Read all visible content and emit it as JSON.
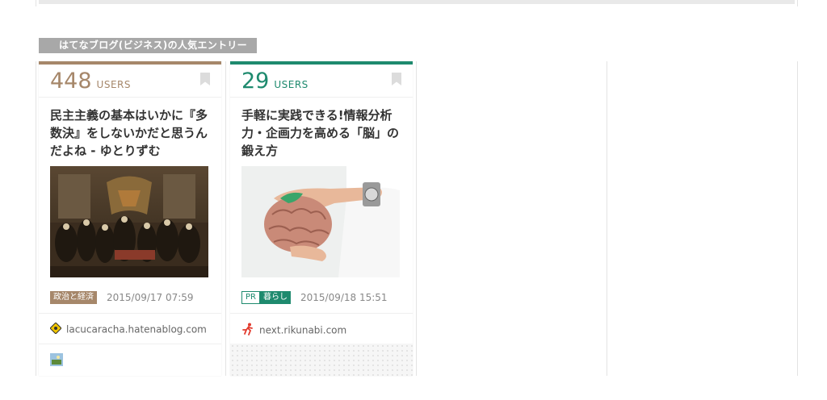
{
  "section": {
    "label": "はてなブログ(ビジネス)の人気エントリー"
  },
  "entries": [
    {
      "users_count": "448",
      "users_unit": "USERS",
      "title": "民主主義の基本はいかに『多数決』をしないかだと思うんだよね - ゆとりずむ",
      "category": "政治と経済",
      "date": "2015/09/17 07:59",
      "domain": "lacucaracha.hatenablog.com",
      "accent_color": "#a6876a",
      "thumb_icon": "painting-image",
      "site_icon": "site-favicon-diamond"
    },
    {
      "users_count": "29",
      "users_unit": "USERS",
      "title": "手軽に実践できる!情報分析力・企画力を高める「脳」の鍛え方",
      "pr_label": "PR",
      "category": "暮らし",
      "date": "2015/09/18 15:51",
      "domain": "next.rikunabi.com",
      "accent_color": "#1e8a6e",
      "thumb_icon": "brain-model-image",
      "site_icon": "runner-icon"
    }
  ]
}
